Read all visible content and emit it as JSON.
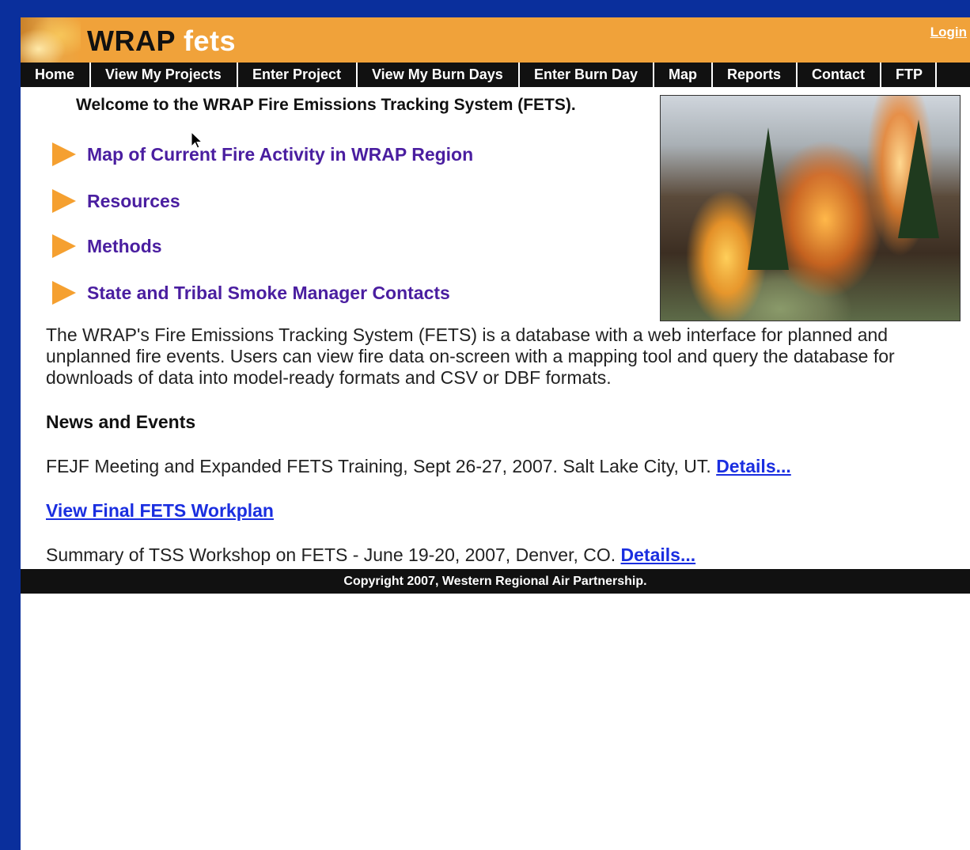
{
  "header": {
    "brand_part1": "WRAP",
    "brand_part2": "fets",
    "login_label": "Login"
  },
  "nav": {
    "items": [
      {
        "label": "Home"
      },
      {
        "label": "View My Projects"
      },
      {
        "label": "Enter Project"
      },
      {
        "label": "View My Burn Days"
      },
      {
        "label": "Enter Burn Day"
      },
      {
        "label": "Map"
      },
      {
        "label": "Reports"
      },
      {
        "label": "Contact"
      },
      {
        "label": "FTP"
      }
    ]
  },
  "main": {
    "welcome": "Welcome to the WRAP Fire Emissions Tracking System (FETS).",
    "quick_links": [
      {
        "label": "Map of Current Fire Activity in WRAP Region"
      },
      {
        "label": "Resources"
      },
      {
        "label": "Methods"
      },
      {
        "label": "State and Tribal Smoke Manager Contacts"
      }
    ],
    "description": "The WRAP's Fire Emissions Tracking System (FETS) is a database with a web interface for planned and unplanned fire events. Users can view fire data on-screen with a mapping tool and query the database for downloads of data into model-ready formats and CSV or DBF formats.",
    "news_heading": "News and Events",
    "news": [
      {
        "text": "FEJF Meeting and Expanded FETS Training, Sept 26-27, 2007. Salt Lake City, UT. ",
        "link": "Details..."
      },
      {
        "text": "",
        "link": "View Final FETS Workplan"
      },
      {
        "text": "Summary of TSS Workshop on FETS - June 19-20, 2007, Denver, CO. ",
        "link": "Details..."
      }
    ]
  },
  "footer": {
    "copyright": "Copyright 2007, Western Regional Air Partnership."
  },
  "colors": {
    "banner": "#f0a23a",
    "nav_bg": "#111111",
    "quick_link": "#4a1ea0",
    "link": "#1a2ee0",
    "outer_bg": "#0a2f9c"
  },
  "icons": {
    "bullet": "arrow-right-icon",
    "cursor": "mouse-pointer-icon"
  }
}
